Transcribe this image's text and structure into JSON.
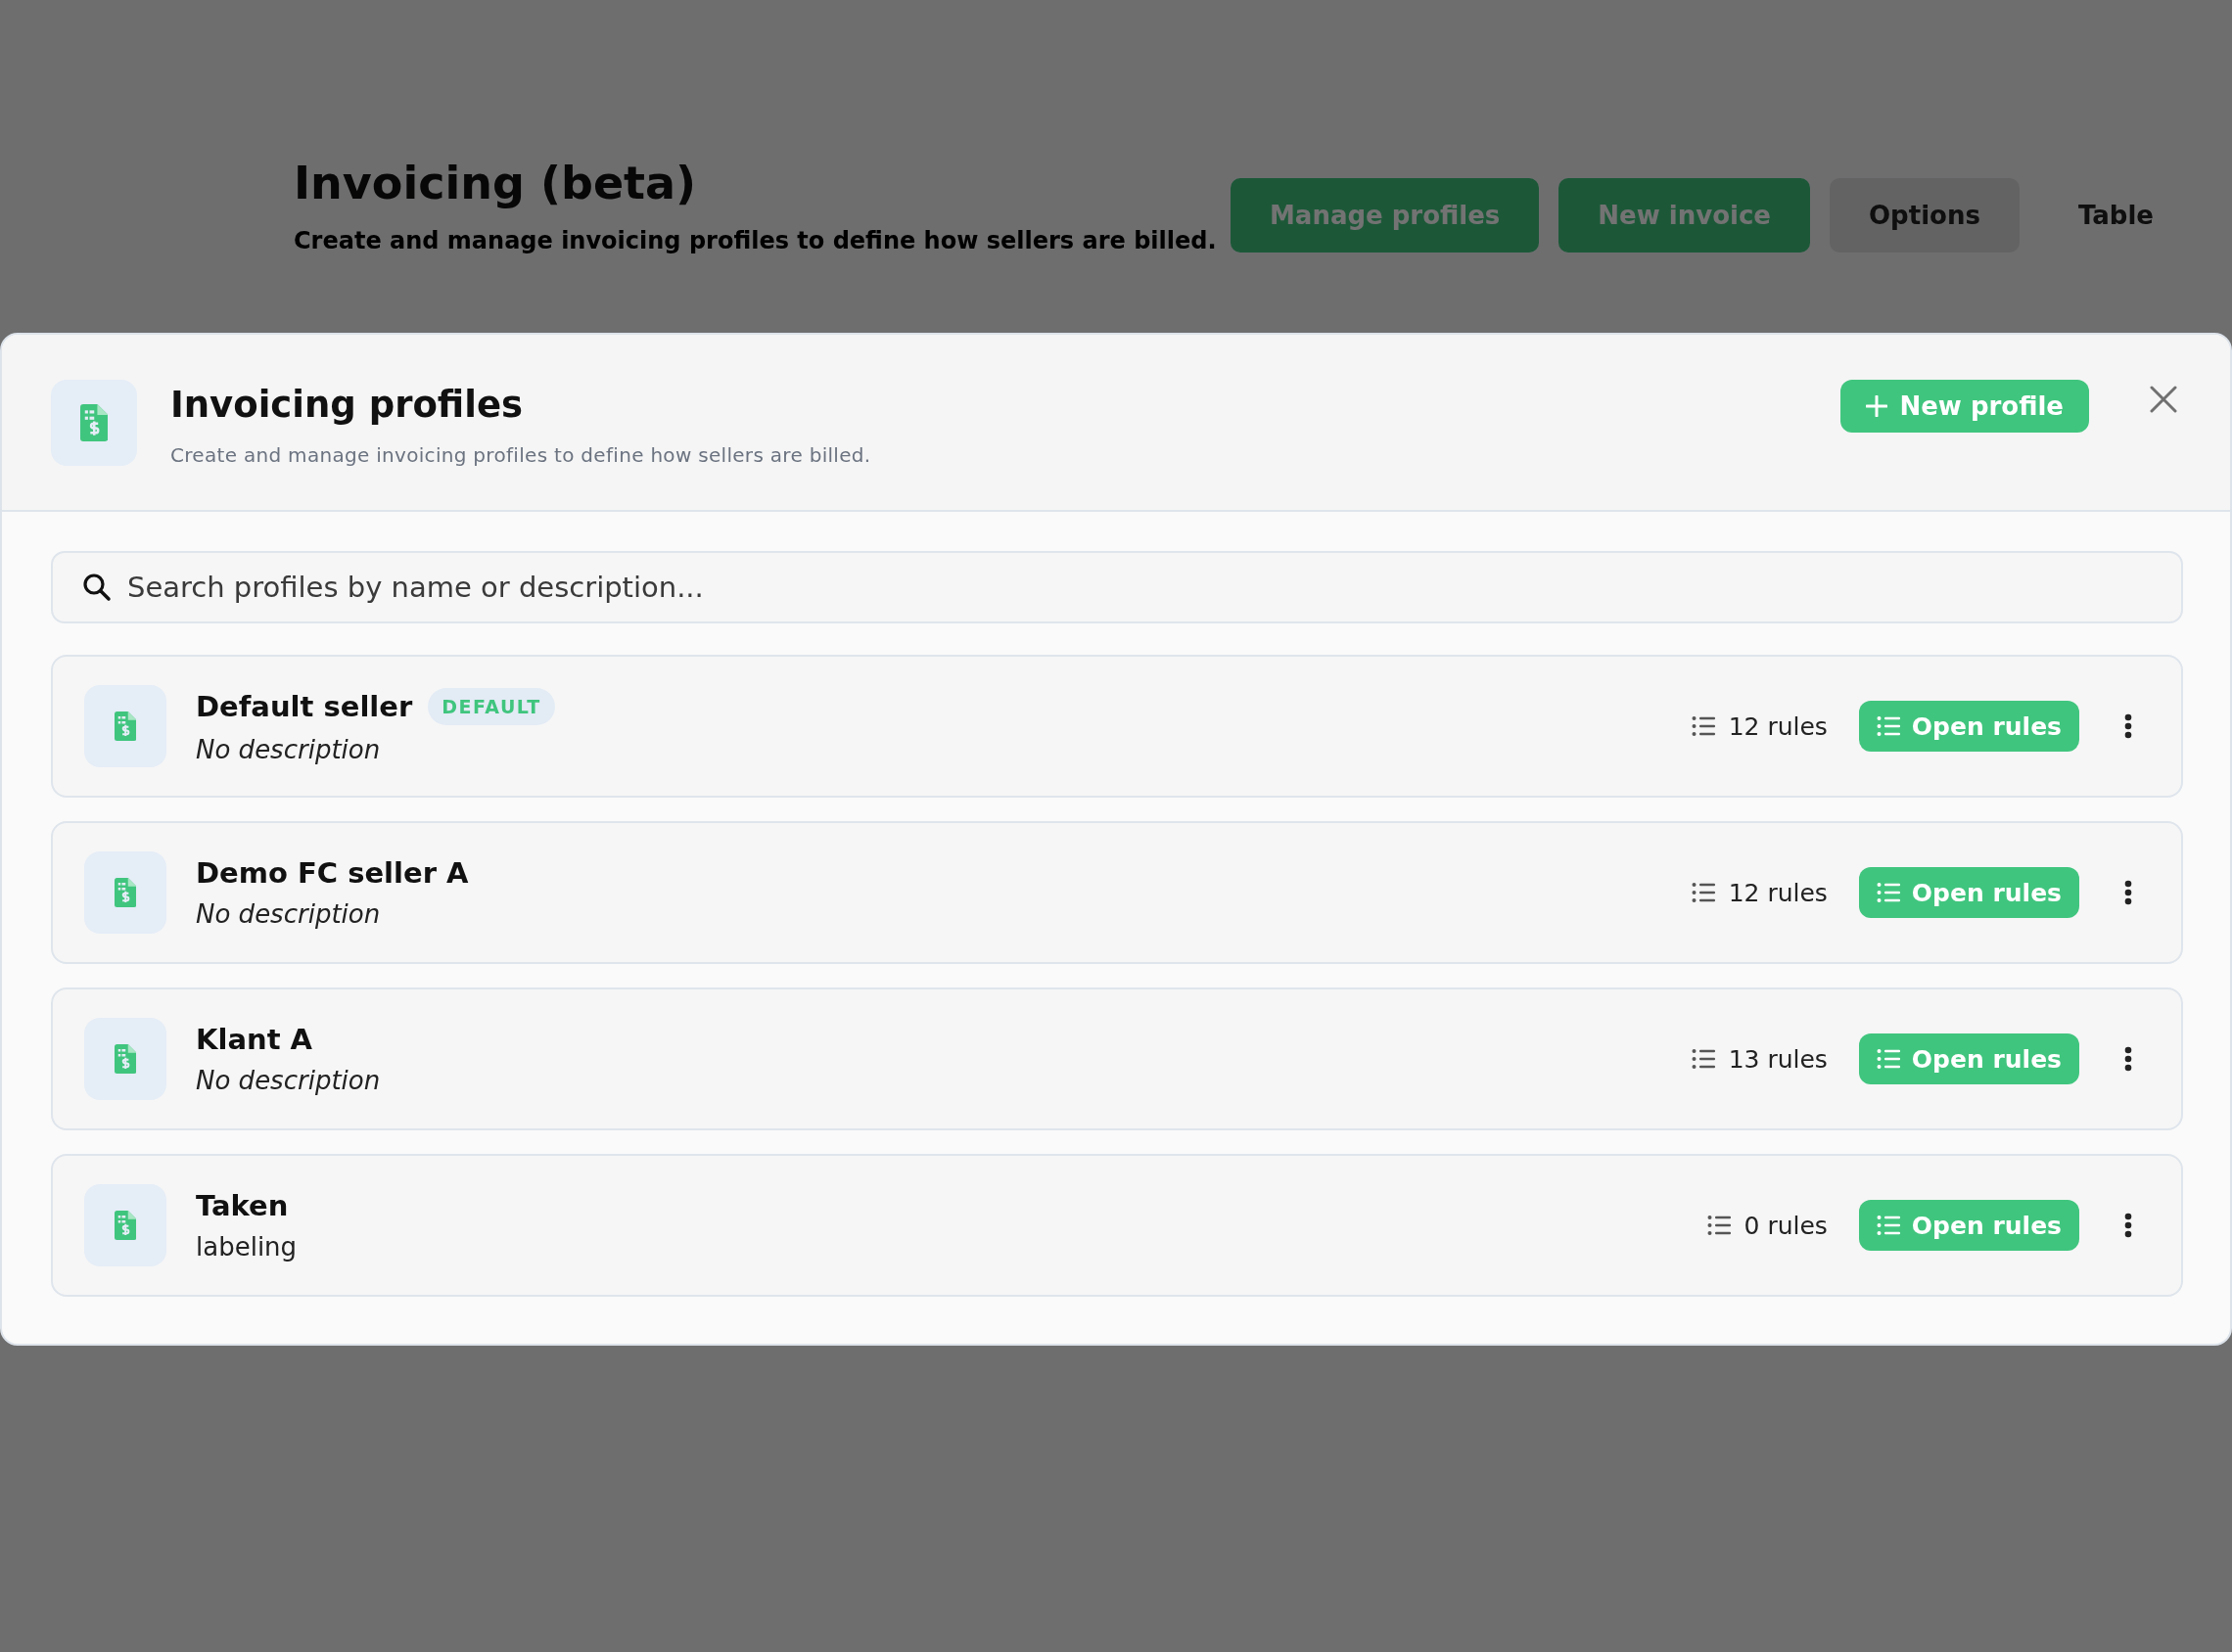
{
  "background_page": {
    "title": "Invoicing (beta)",
    "subtitle": "Create and manage invoicing profiles to define how sellers are billed.",
    "buttons": [
      {
        "label": "Manage profiles",
        "kind": "primary"
      },
      {
        "label": "New invoice",
        "kind": "primary"
      },
      {
        "label": "Options",
        "kind": "menu"
      },
      {
        "label": "Table",
        "kind": "plain"
      }
    ]
  },
  "dialog": {
    "title": "Invoicing profiles",
    "subtitle": "Create and manage invoicing profiles to define how sellers are billed.",
    "new_button": "New profile",
    "search": {
      "placeholder": "Search profiles by name or description..."
    },
    "profiles": [
      {
        "name": "Default seller",
        "badge": "DEFAULT",
        "description": "No description",
        "description_empty": true,
        "rules": "12 rules",
        "button": "Open rules"
      },
      {
        "name": "Demo FC seller A",
        "description": "No description",
        "description_empty": true,
        "rules": "12 rules",
        "button": "Open rules"
      },
      {
        "name": "Klant A",
        "description": "No description",
        "description_empty": true,
        "rules": "13 rules",
        "button": "Open rules"
      },
      {
        "name": "Taken",
        "description": "labeling",
        "description_empty": false,
        "rules": "0 rules",
        "button": "Open rules"
      }
    ]
  }
}
